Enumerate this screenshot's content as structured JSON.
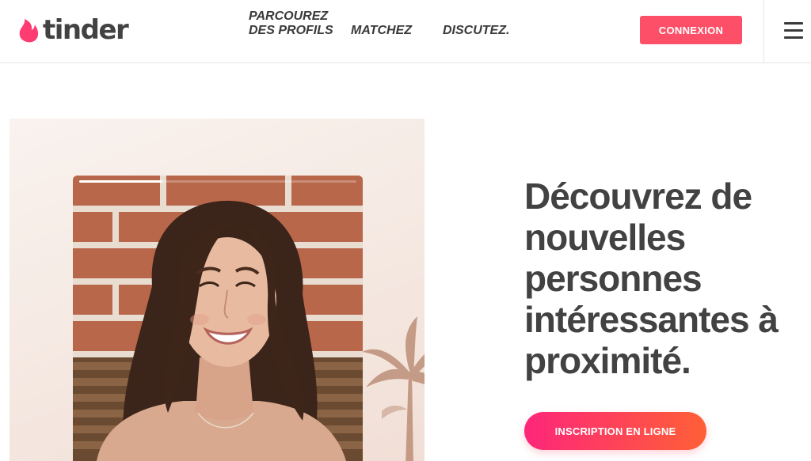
{
  "brand": {
    "name": "tinder",
    "flame_color": "#fe3c72",
    "text_color": "#424242"
  },
  "nav": {
    "items": [
      {
        "label": "PARCOUREZ DES PROFILS"
      },
      {
        "label": "MATCHEZ"
      },
      {
        "label": "DISCUTEZ."
      }
    ],
    "login_label": "CONNEXION",
    "menu_icon": "hamburger-icon"
  },
  "hero": {
    "title": "Découvrez de nouvelles personnes intéressantes à proximité.",
    "signup_label": "INSCRIPTION EN LIGNE",
    "profile_photo_progress": 0.3
  },
  "colors": {
    "accent": "#fd5068",
    "gradient_start": "#fd267a",
    "gradient_end": "#ff6036"
  }
}
